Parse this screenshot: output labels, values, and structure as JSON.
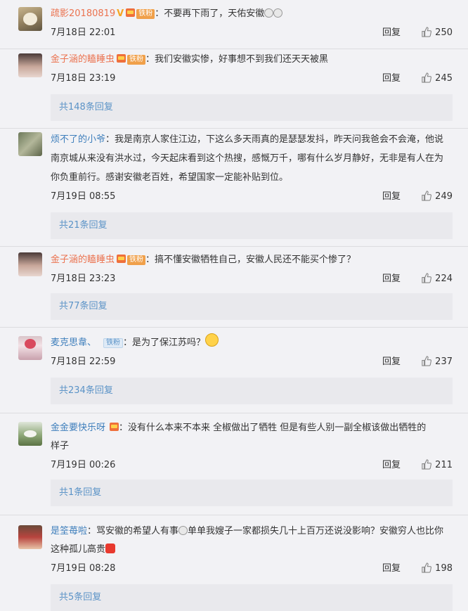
{
  "comments": [
    {
      "username": "疏影20180819",
      "badge": "铁粉",
      "text": "：不要再下雨了，天佑安徽",
      "time": "7月18日 22:01",
      "reply": "回复",
      "likes": "250"
    },
    {
      "username": "金子涵的瞌睡虫",
      "badge": "铁粉",
      "text": "：我们安徽实惨，好事想不到我们还天天被黑",
      "time": "7月18日 23:19",
      "reply": "回复",
      "likes": "245",
      "replies": "共148条回复"
    },
    {
      "username": "烦不了的小爷",
      "text_line1": "：我是南京人家住江边，下这么多天雨真的是瑟瑟发抖，昨天问我爸会不会淹，他说",
      "text_line2": "南京城从来没有洪水过，今天起床看到这个热搜，感慨万千，哪有什么岁月静好，无非是有人在为",
      "text_line3": "你负重前行。感谢安徽老百姓，希望国家一定能补贴到位。",
      "time": "7月19日 08:55",
      "reply": "回复",
      "likes": "249",
      "replies": "共21条回复"
    },
    {
      "username": "金子涵的瞌睡虫",
      "badge": "铁粉",
      "text": "：搞不懂安徽牺牲自己，安徽人民还不能买个惨了？",
      "time": "7月18日 23:23",
      "reply": "回复",
      "likes": "224",
      "replies": "共77条回复"
    },
    {
      "username": "麦克思韋、",
      "badge": "铁粉",
      "text": "：是为了保江苏吗？",
      "time": "7月18日 22:59",
      "reply": "回复",
      "likes": "237",
      "replies": "共234条回复"
    },
    {
      "username": "金金要快乐呀",
      "text_line1": "：没有什么本来不本来 全椒做出了牺牲  但是有些人别一副全椒该做出牺牲的",
      "text_line2": "样子",
      "time": "7月19日 00:26",
      "reply": "回复",
      "likes": "211",
      "replies": "共1条回复"
    },
    {
      "username": "是筌苺啦",
      "text_line1a": "：骂安徽的希望人有事",
      "text_line1b": "单单我嫂子一家都损失几十上百万还说没影响？安徽穷人也比你",
      "text_line2": "这种孤儿高贵",
      "time": "7月19日 08:28",
      "reply": "回复",
      "likes": "198",
      "replies": "共5条回复"
    }
  ],
  "colors": {
    "username": "#eb7350",
    "link": "#5b93c7",
    "background": "#f2f2f5"
  }
}
